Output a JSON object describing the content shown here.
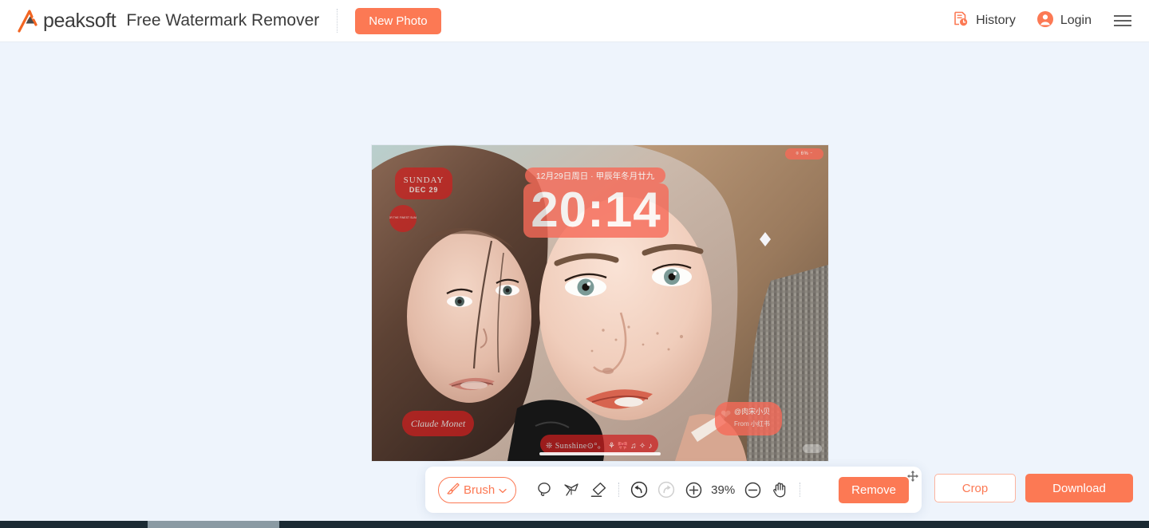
{
  "header": {
    "logo_text": "peaksoft",
    "logo_icon": "apeaksoft-a-logo-icon",
    "app_title": "Free Watermark Remover",
    "new_photo_label": "New Photo",
    "history_label": "History",
    "history_icon": "history-clock-icon",
    "login_label": "Login",
    "login_icon": "user-avatar-icon",
    "menu_icon": "hamburger-menu-icon",
    "accent_color": "#fc7954",
    "background": "#ffffff"
  },
  "canvas": {
    "background": "#eef4fc",
    "photo_alt": "two-people-selfie-photo",
    "watermarks": [
      {
        "id": "sunday",
        "line1": "SUNDAY",
        "line2": "DEC 29"
      },
      {
        "id": "seal",
        "text": "HONOR THE FINEST SUNLOOK"
      },
      {
        "id": "date-bar",
        "text": "12月29日周日 · 甲辰年冬月廿九"
      },
      {
        "id": "clock",
        "text": "20:14"
      },
      {
        "id": "status-bar",
        "text": "⌾ 6% ⌁"
      },
      {
        "id": "signature",
        "text": "Claude Monet"
      },
      {
        "id": "sunshine",
        "text": "❊ Sunshine⊙°。 ⚘ 🎀 ♫ ✧ ♪"
      },
      {
        "id": "handle",
        "line1": "@肉宋小贝",
        "line2": "From 小红书"
      }
    ]
  },
  "toolbar": {
    "brush_label": "Brush",
    "brush_icon": "paint-brush-icon",
    "brush_chevron_icon": "chevron-down-icon",
    "lasso_icon": "lasso-select-icon",
    "polygon_lasso_icon": "polygon-lasso-icon",
    "eraser_icon": "eraser-icon",
    "undo_icon": "undo-arrow-icon",
    "redo_icon": "redo-arrow-icon",
    "zoom_in_icon": "zoom-in-icon",
    "zoom_out_icon": "zoom-out-icon",
    "hand_icon": "hand-pan-icon",
    "move_handle_icon": "move-handle-icon",
    "zoom_level": "39%",
    "remove_label": "Remove",
    "undo_enabled": "true",
    "redo_enabled": "false"
  },
  "actions": {
    "crop_label": "Crop",
    "download_label": "Download"
  }
}
